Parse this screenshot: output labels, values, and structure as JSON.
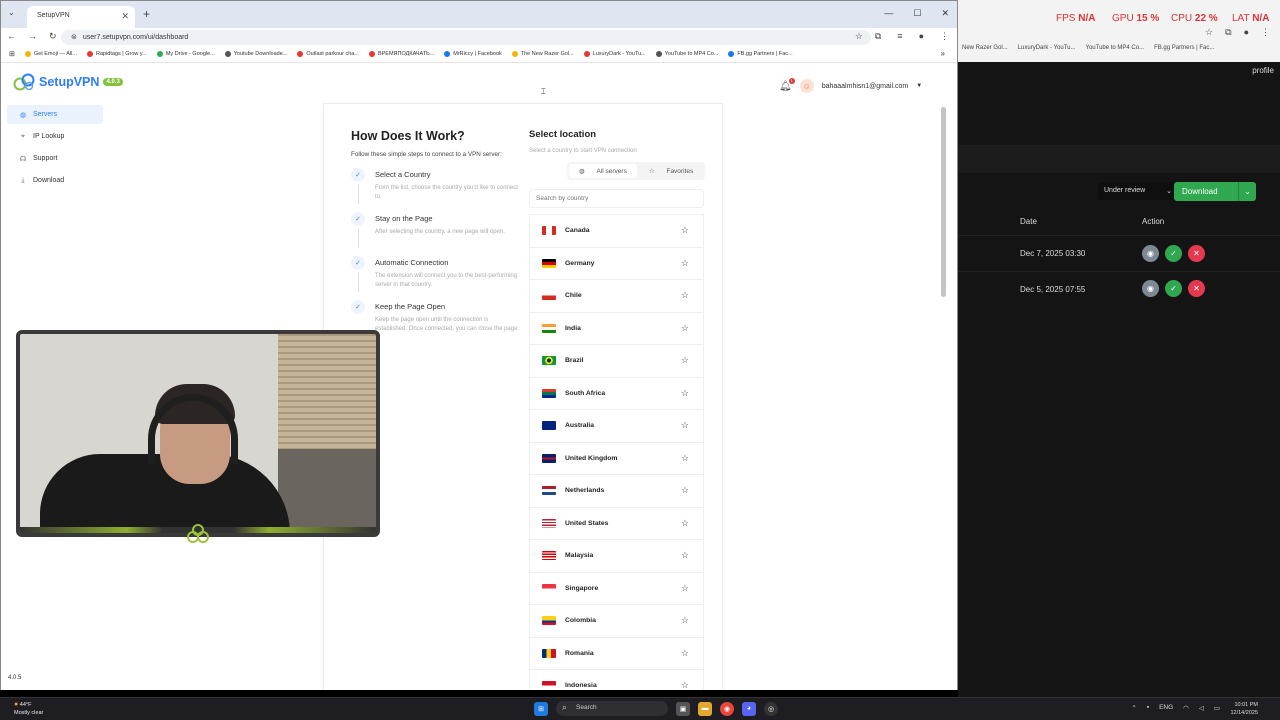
{
  "browser": {
    "tab_title": "SetupVPN",
    "url": "user7.setupvpn.com/ui/dashboard",
    "bookmarks": [
      {
        "label": "Get Emoji — All...",
        "color": "#f5b400"
      },
      {
        "label": "Rapidtags | Grow y...",
        "color": "#e53935"
      },
      {
        "label": "My Drive - Google...",
        "color": "#34a853"
      },
      {
        "label": "Youtube Downloade...",
        "color": "#555"
      },
      {
        "label": "Outlast parkour cha...",
        "color": "#e53935"
      },
      {
        "label": "ВРЕМЯПОДКАЧАТЬ...",
        "color": "#e53935"
      },
      {
        "label": "MrRiccy | Facebook",
        "color": "#1877f2"
      },
      {
        "label": "The New Razer Gol...",
        "color": "#f5b400"
      },
      {
        "label": "LuxuryDark - YouTu...",
        "color": "#e53935"
      },
      {
        "label": "YouTube to MP4 Co...",
        "color": "#555"
      },
      {
        "label": "FB.gg Partners | Fac...",
        "color": "#1877f2"
      }
    ]
  },
  "app": {
    "brand": "SetupVPN",
    "version_badge": "4.0.3",
    "footer_version": "4.0.5",
    "sidebar": [
      {
        "label": "Servers",
        "icon": "globe-icon",
        "active": true
      },
      {
        "label": "IP Lookup",
        "icon": "location-pin-icon",
        "active": false
      },
      {
        "label": "Support",
        "icon": "headset-icon",
        "active": false
      },
      {
        "label": "Download",
        "icon": "download-icon",
        "active": false
      }
    ],
    "notifications_count": "1",
    "user_email": "bahaaalmhisn1@gmail.com"
  },
  "how": {
    "title": "How Does It Work?",
    "subtitle": "Follow these simple steps to connect to a VPN server:",
    "steps": [
      {
        "title": "Select a Country",
        "desc": "From the list, choose the country you'd like to connect to."
      },
      {
        "title": "Stay on the Page",
        "desc": "After selecting the country, a new page will open."
      },
      {
        "title": "Automatic Connection",
        "desc": "The extension will connect you to the best-performing server in that country."
      },
      {
        "title": "Keep the Page Open",
        "desc": "Keep the page open until the connection is established. Once connected, you can close the page."
      }
    ]
  },
  "location": {
    "title": "Select location",
    "subtitle": "Select a country to start VPN connection",
    "tab_all": "All servers",
    "tab_fav": "Favorites",
    "search_placeholder": "Search by country",
    "countries": [
      "Canada",
      "Germany",
      "Chile",
      "India",
      "Brazil",
      "South Africa",
      "Australia",
      "United Kingdom",
      "Netherlands",
      "United States",
      "Malaysia",
      "Singapore",
      "Colombia",
      "Romania",
      "Indonesia"
    ]
  },
  "background_window": {
    "hud": {
      "fps_label": "FPS",
      "fps": "N/A",
      "gpu_label": "GPU",
      "gpu": "15 %",
      "cpu_label": "CPU",
      "cpu": "22 %",
      "lat_label": "LAT",
      "lat": "N/A"
    },
    "bookmarks": [
      "New Razer Gol...",
      "LuxuryDark - YouTu...",
      "YouTube to MP4 Co...",
      "FB.gg Partners | Fac..."
    ],
    "profile_label": "profile",
    "filter_value": "Under review",
    "download_label": "Download",
    "col_date": "Date",
    "col_action": "Action",
    "rows": [
      {
        "date": "Dec 7, 2025 03:30"
      },
      {
        "date": "Dec 5, 2025 07:55"
      }
    ]
  },
  "taskbar": {
    "temp": "44°F",
    "weather": "Mostly clear",
    "search_label": "Search",
    "lang": "ENG",
    "time": "10:01 PM",
    "date": "12/14/2025"
  },
  "colors": {
    "accent": "#2d7ef7",
    "badge": "#84c23e",
    "download": "#2fa84f"
  }
}
